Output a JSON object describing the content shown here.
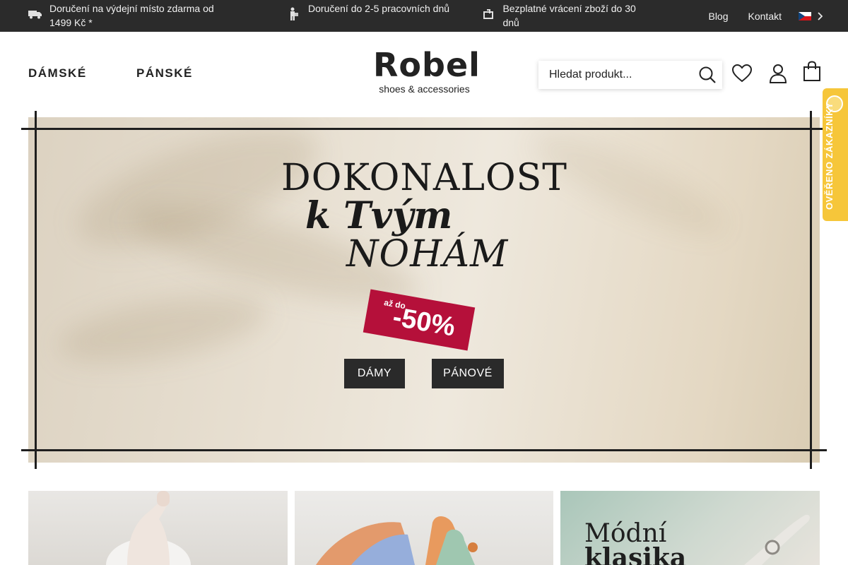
{
  "topbar": {
    "info": [
      {
        "icon": "truck-icon",
        "text": "Doručení na výdejní místo zdarma od 1499 Kč *"
      },
      {
        "icon": "courier-icon",
        "text": "Doručení do 2-5 pracovních dnů"
      },
      {
        "icon": "return-icon",
        "text": "Bezplatné vrácení zboží do 30 dnů"
      }
    ],
    "links": {
      "blog": "Blog",
      "contact": "Kontakt"
    },
    "language": {
      "flag": "cz-flag-icon",
      "chevron": "chevron-right-icon"
    }
  },
  "header": {
    "nav": {
      "women": "DÁMSKÉ",
      "men": "PÁNSKÉ"
    },
    "logo": {
      "brand": "Robel",
      "tagline": "shoes & accessories"
    },
    "search": {
      "placeholder": "Hledat produkt...",
      "icon": "search-icon"
    },
    "icons": [
      "heart-icon",
      "user-icon",
      "cart-icon"
    ]
  },
  "hero": {
    "line1": "DOKONALOST",
    "line2": "k Tvým",
    "line3": "NOHÁM",
    "badge_small": "až do",
    "badge_big": "-50%",
    "buttons": {
      "women": "DÁMY",
      "men": "PÁNOVÉ"
    }
  },
  "verified": {
    "label": "OVĚŘENO ZÁKAZNÍKY"
  },
  "tiles": {
    "third": {
      "line1": "Módní",
      "line2": "klasika"
    }
  },
  "colors": {
    "topbar": "#2b2b2b",
    "badge": "#b5103a",
    "verified": "#f6c63a",
    "button": "#2a2a2a"
  }
}
